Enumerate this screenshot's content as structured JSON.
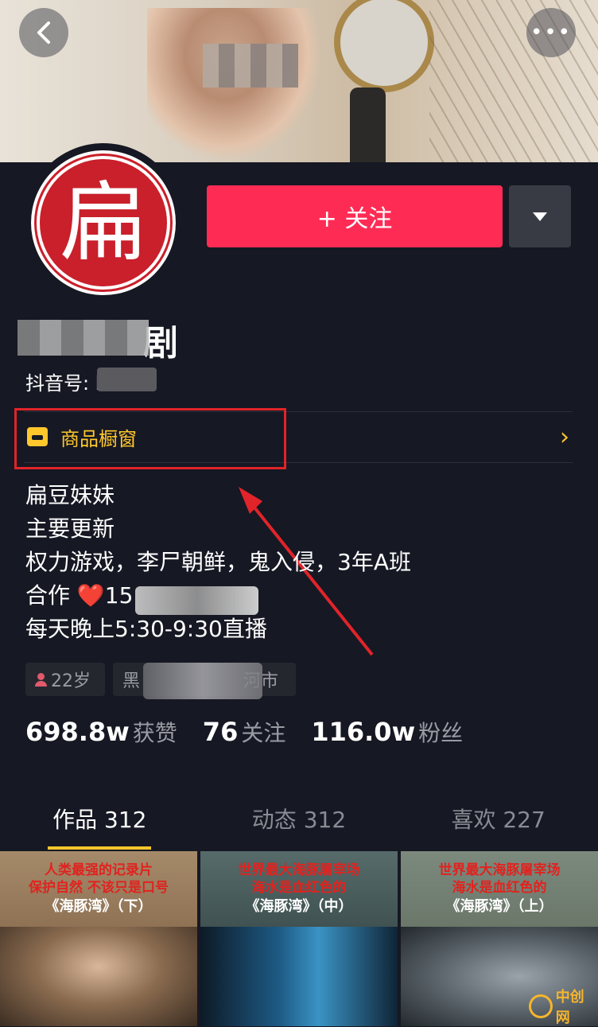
{
  "header": {
    "back_icon": "chevron-left-icon",
    "more_label": "•••"
  },
  "avatar": {
    "char": "扁"
  },
  "actions": {
    "follow_label": "+ 关注",
    "dropdown_icon": "triangle-down-icon"
  },
  "profile": {
    "name_visible_part": "剧",
    "douyin_id_label": "抖音号: h"
  },
  "showcase": {
    "label": "商品橱窗",
    "chevron": "›"
  },
  "bio": {
    "line1": "扁豆妹妹",
    "line2": "主要更新",
    "line3": "权力游戏，李尸朝鲜，鬼入侵，3年A班",
    "line4_prefix": "合作",
    "line4_heart": "❤️",
    "line4_number": "15",
    "line5": "每天晚上5:30-9:30直播"
  },
  "tags": {
    "age": "22岁",
    "location_start": "黑",
    "location_end": "河市"
  },
  "stats": {
    "likes_num": "698.8w",
    "likes_label": "获赞",
    "following_num": "76",
    "following_label": "关注",
    "fans_num": "116.0w",
    "fans_label": "粉丝"
  },
  "tabs": {
    "works": "作品 312",
    "dynamics": "动态 312",
    "likes": "喜欢 227"
  },
  "videos": [
    {
      "line1": "人类最强的记录片",
      "line2": "保护自然 不该只是口号",
      "line3": "《海豚湾》（下）"
    },
    {
      "line1": "世界最大海豚屠宰场",
      "line2": "海水是血红色的",
      "line3": "《海豚湾》（中）"
    },
    {
      "line1": "世界最大海豚屠宰场",
      "line2": "海水是血红色的",
      "line3": "《海豚湾》（上）"
    }
  ],
  "watermark": {
    "text": "中创网"
  },
  "colors": {
    "background": "#161823",
    "follow_button": "#fe2c55",
    "showcase_accent": "#ffc72c",
    "highlight_box": "#e0242a"
  }
}
